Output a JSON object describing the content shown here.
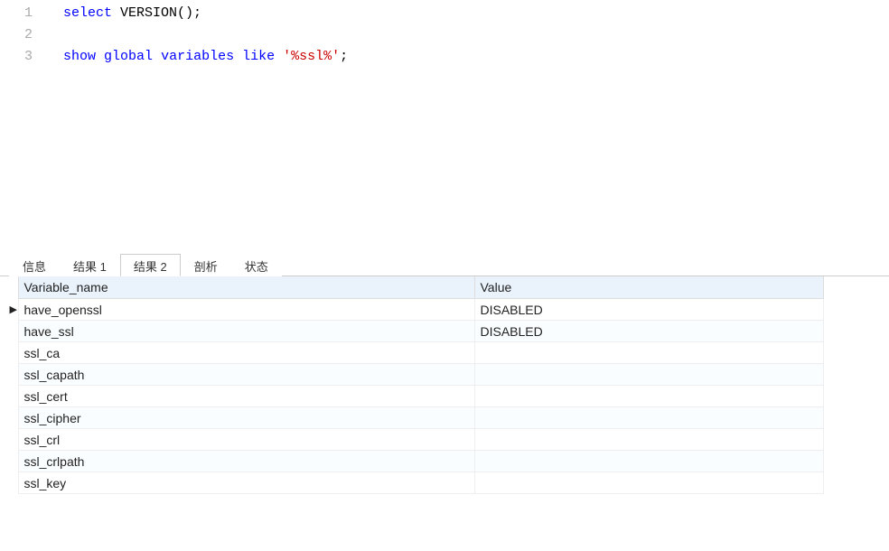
{
  "editor": {
    "lines": [
      {
        "num": "1",
        "tokens": [
          {
            "text": "select",
            "cls": "kw-blue"
          },
          {
            "text": " ",
            "cls": ""
          },
          {
            "text": "VERSION",
            "cls": "kw-func"
          },
          {
            "text": "();",
            "cls": "kw-paren"
          }
        ]
      },
      {
        "num": "2",
        "tokens": []
      },
      {
        "num": "3",
        "tokens": [
          {
            "text": "show",
            "cls": "kw-blue"
          },
          {
            "text": " ",
            "cls": ""
          },
          {
            "text": "global",
            "cls": "kw-blue"
          },
          {
            "text": " ",
            "cls": ""
          },
          {
            "text": "variables",
            "cls": "kw-blue"
          },
          {
            "text": " ",
            "cls": ""
          },
          {
            "text": "like",
            "cls": "kw-blue"
          },
          {
            "text": " ",
            "cls": ""
          },
          {
            "text": "'%ssl%'",
            "cls": "kw-string"
          },
          {
            "text": ";",
            "cls": "kw-paren"
          }
        ]
      }
    ]
  },
  "tabs": {
    "items": [
      {
        "label": "信息",
        "active": false
      },
      {
        "label": "结果 1",
        "active": false
      },
      {
        "label": "结果 2",
        "active": true
      },
      {
        "label": "剖析",
        "active": false
      },
      {
        "label": "状态",
        "active": false
      }
    ]
  },
  "results": {
    "columns": [
      "Variable_name",
      "Value"
    ],
    "rows": [
      {
        "indicator": "▶",
        "variable": "have_openssl",
        "value": "DISABLED"
      },
      {
        "indicator": "",
        "variable": "have_ssl",
        "value": "DISABLED"
      },
      {
        "indicator": "",
        "variable": "ssl_ca",
        "value": ""
      },
      {
        "indicator": "",
        "variable": "ssl_capath",
        "value": ""
      },
      {
        "indicator": "",
        "variable": "ssl_cert",
        "value": ""
      },
      {
        "indicator": "",
        "variable": "ssl_cipher",
        "value": ""
      },
      {
        "indicator": "",
        "variable": "ssl_crl",
        "value": ""
      },
      {
        "indicator": "",
        "variable": "ssl_crlpath",
        "value": ""
      },
      {
        "indicator": "",
        "variable": "ssl_key",
        "value": ""
      }
    ]
  }
}
